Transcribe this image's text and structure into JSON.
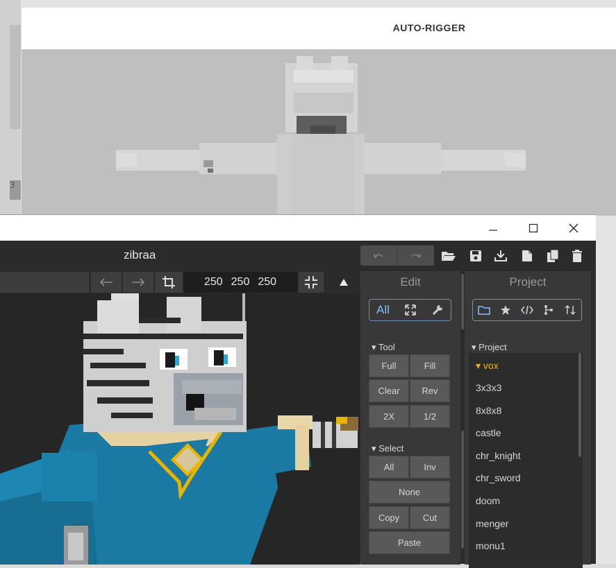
{
  "background_window": {
    "title": "AUTO-RIGGER",
    "edge_glyph": "3"
  },
  "window": {
    "minimize_icon": "minimize-icon",
    "maximize_icon": "maximize-icon",
    "close_icon": "close-icon"
  },
  "header": {
    "title": "zibraa",
    "toolbar_icons": [
      "undo-icon",
      "redo-icon",
      "open-folder-icon",
      "save-icon",
      "download-icon",
      "new-file-icon",
      "duplicate-icon",
      "trash-icon"
    ]
  },
  "viewbar": {
    "size_x": "250",
    "size_y": "250",
    "size_z": "250"
  },
  "edit_panel": {
    "title": "Edit",
    "tab_all": "All",
    "tool_section": "▾ Tool",
    "tool_buttons": [
      "Full",
      "Fill",
      "Clear",
      "Rev",
      "2X",
      "1/2"
    ],
    "select_section": "▾ Select",
    "select_all": "All",
    "select_inv": "Inv",
    "select_none": "None",
    "copy": "Copy",
    "cut": "Cut",
    "paste": "Paste"
  },
  "project_panel": {
    "title": "Project",
    "section": "▾ Project",
    "items": [
      "▾ vox",
      "3x3x3",
      "8x8x8",
      "castle",
      "chr_knight",
      "chr_sword",
      "doom",
      "menger",
      "monu1"
    ],
    "selected_color": "#f0b400"
  },
  "colors": {
    "accent_blue": "#7fbfff",
    "character_blue": "#1a7aa3",
    "gold": "#e8b400"
  }
}
